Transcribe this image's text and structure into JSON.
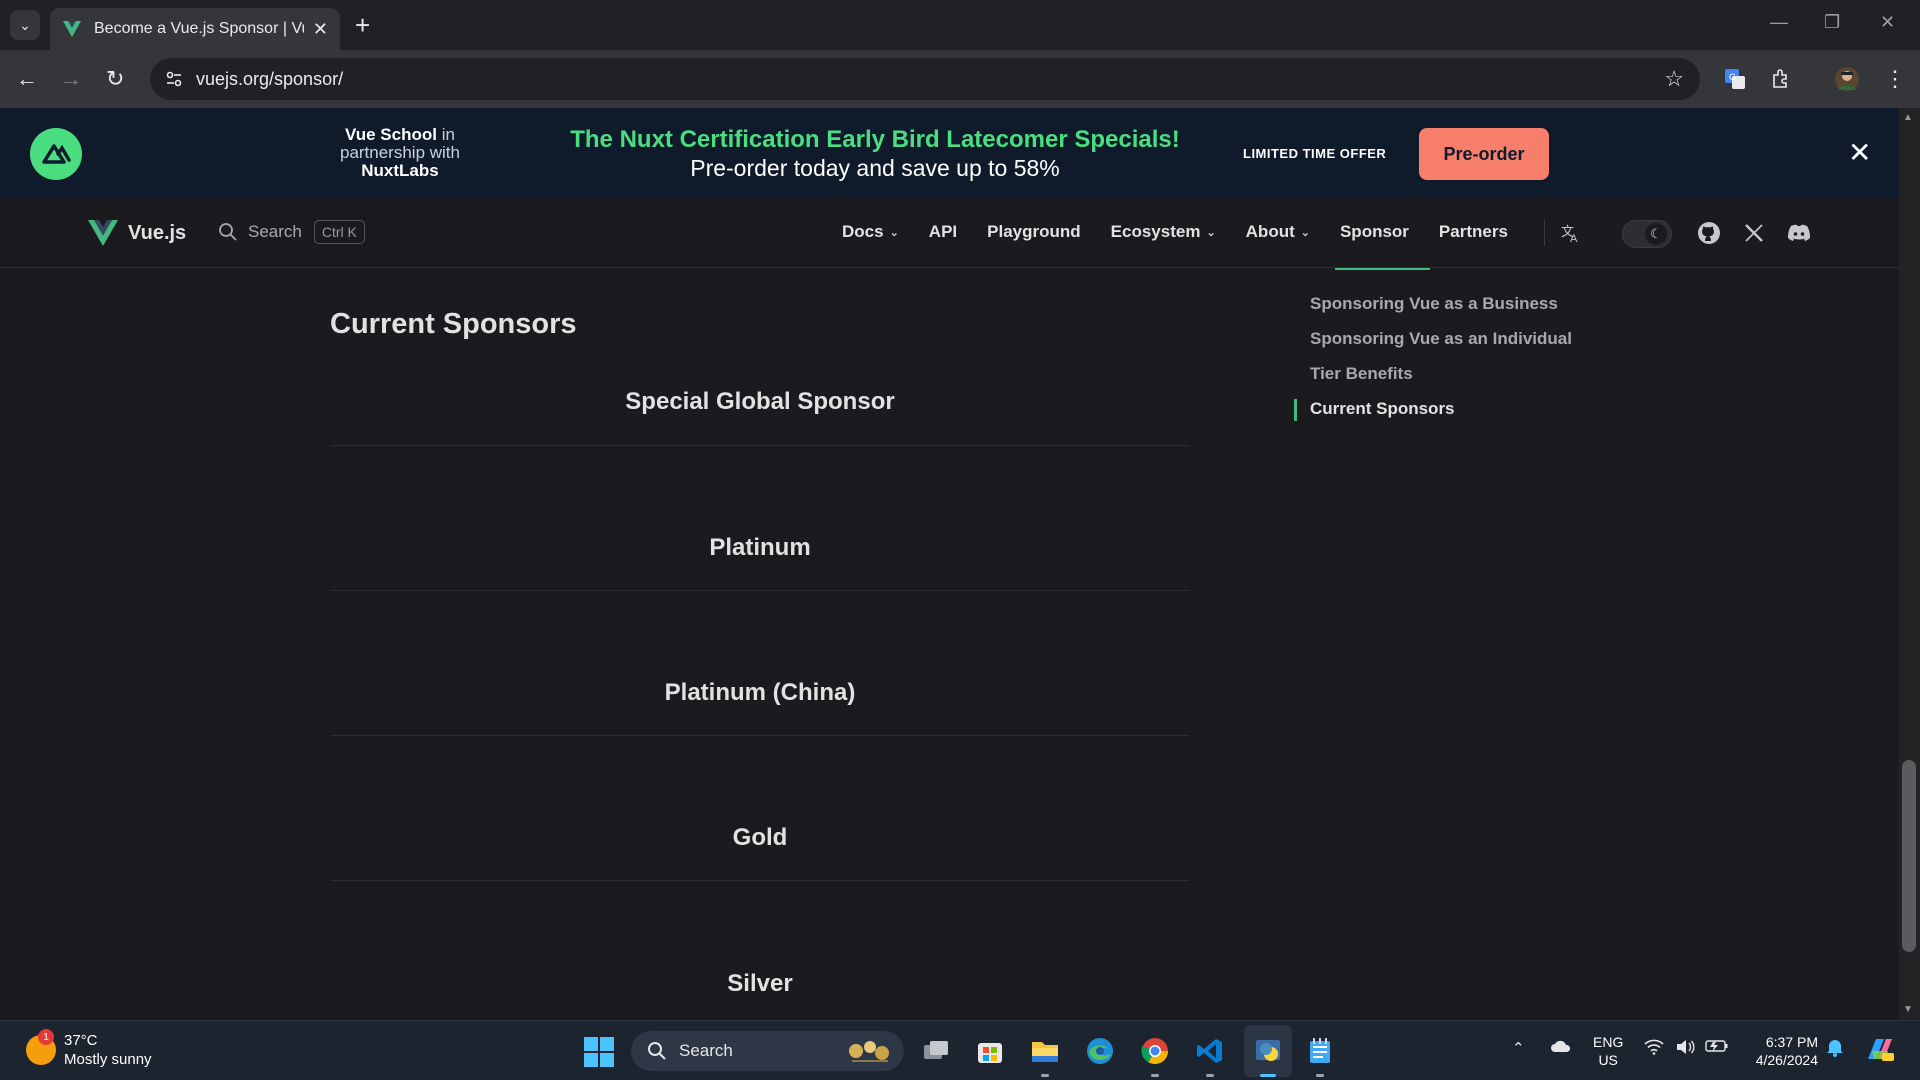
{
  "browser": {
    "tab_title": "Become a Vue.js Sponsor | Vue.js",
    "url": "vuejs.org/sponsor/"
  },
  "banner": {
    "partner_line1": "Vue School",
    "partner_line1_suffix": " in",
    "partner_line2": "partnership with",
    "partner_line3": "NuxtLabs",
    "promo_title": "The Nuxt Certification Early Bird Latecomer Specials!",
    "promo_subtitle": "Pre-order today and save up to 58%",
    "limited": "LIMITED TIME OFFER",
    "cta": "Pre-order"
  },
  "nav": {
    "brand": "Vue.js",
    "search_label": "Search",
    "search_kbd": "Ctrl K",
    "links": [
      "Docs",
      "API",
      "Playground",
      "Ecosystem",
      "About",
      "Sponsor",
      "Partners"
    ]
  },
  "content": {
    "heading": "Current Sponsors",
    "tiers": [
      "Special Global Sponsor",
      "Platinum",
      "Platinum (China)",
      "Gold",
      "Silver"
    ]
  },
  "toc": {
    "items": [
      "Sponsoring Vue as a Business",
      "Sponsoring Vue as an Individual",
      "Tier Benefits",
      "Current Sponsors"
    ],
    "active": "Current Sponsors"
  },
  "taskbar": {
    "weather_temp": "37°C",
    "weather_desc": "Mostly sunny",
    "weather_badge": "1",
    "search_label": "Search",
    "lang1": "ENG",
    "lang2": "US",
    "time": "6:37 PM",
    "date": "4/26/2024"
  },
  "colors": {
    "vue_green": "#42b883",
    "promo_green": "#4ade80",
    "cta_bg": "#f87e6c",
    "page_bg": "#1b1b1f"
  }
}
